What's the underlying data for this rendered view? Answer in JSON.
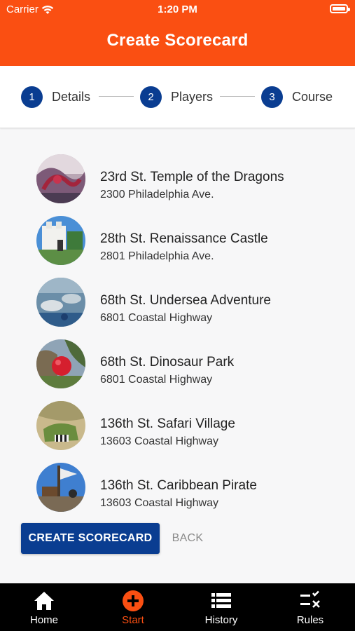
{
  "status_bar": {
    "carrier": "Carrier",
    "time": "1:20 PM"
  },
  "header": {
    "title": "Create Scorecard"
  },
  "stepper": {
    "steps": [
      {
        "number": "1",
        "label": "Details"
      },
      {
        "number": "2",
        "label": "Players"
      },
      {
        "number": "3",
        "label": "Course"
      }
    ]
  },
  "courses": [
    {
      "name": "23rd St. Temple of the Dragons",
      "address": "2300 Philadelphia Ave."
    },
    {
      "name": "28th St. Renaissance Castle",
      "address": "2801 Philadelphia Ave."
    },
    {
      "name": "68th St. Undersea Adventure",
      "address": "6801 Coastal Highway"
    },
    {
      "name": "68th St. Dinosaur Park",
      "address": "6801 Coastal Highway"
    },
    {
      "name": "136th St. Safari Village",
      "address": "13603 Coastal Highway"
    },
    {
      "name": "136th St. Caribbean Pirate",
      "address": "13603 Coastal Highway"
    }
  ],
  "actions": {
    "create_label": "CREATE SCORECARD",
    "back_label": "BACK"
  },
  "tabbar": {
    "tabs": [
      {
        "label": "Home",
        "icon": "home-icon"
      },
      {
        "label": "Start",
        "icon": "plus-circle-icon",
        "active": true
      },
      {
        "label": "History",
        "icon": "list-icon"
      },
      {
        "label": "Rules",
        "icon": "checklist-icon"
      }
    ]
  },
  "colors": {
    "brand": "#fa4f12",
    "primary": "#0a3d91",
    "tabbar": "#000000"
  }
}
